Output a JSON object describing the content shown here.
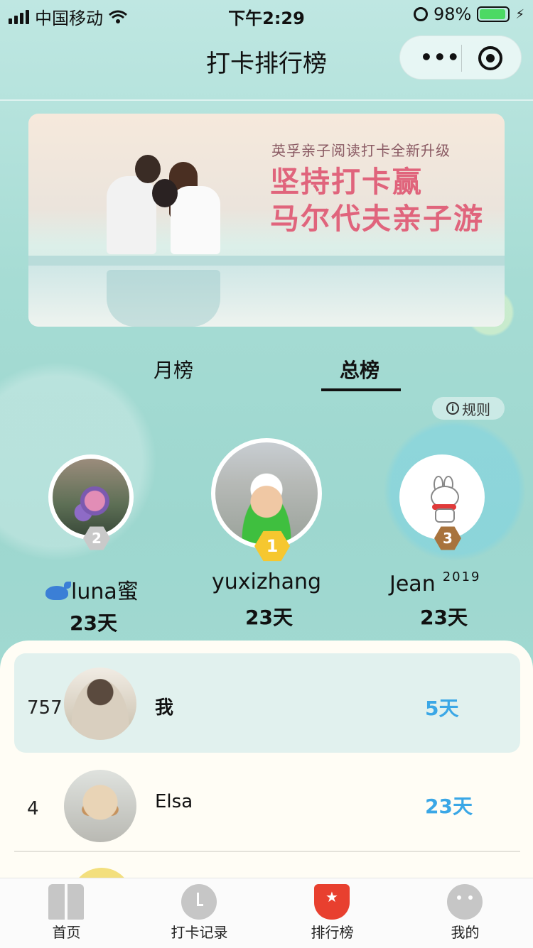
{
  "status_bar": {
    "carrier": "中国移动",
    "time": "下午2:29",
    "battery": "98%"
  },
  "nav": {
    "title": "打卡排行榜"
  },
  "banner": {
    "subtitle": "英孚亲子阅读打卡全新升级",
    "headline_1": "坚持打卡赢",
    "headline_2": "马尔代夫亲子游"
  },
  "tabs": [
    {
      "label": "月榜",
      "active": false
    },
    {
      "label": "总榜",
      "active": true
    }
  ],
  "rules_label": "规则",
  "podium": [
    {
      "rank": "2",
      "name": "luna蜜",
      "days": "23天"
    },
    {
      "rank": "1",
      "name": "yuxizhang",
      "days": "23天"
    },
    {
      "rank": "3",
      "name": "Jean",
      "name_suffix": "2019",
      "days": "23天"
    }
  ],
  "list": [
    {
      "rank": "757",
      "name": "我",
      "days": "5天",
      "highlighted": true
    },
    {
      "rank": "4",
      "name": "Elsa",
      "days": "23天",
      "highlighted": false
    }
  ],
  "tabbar": [
    {
      "label": "首页",
      "icon": "book-icon",
      "active": false
    },
    {
      "label": "打卡记录",
      "icon": "clock-icon",
      "active": false
    },
    {
      "label": "排行榜",
      "icon": "trophy-icon",
      "active": true
    },
    {
      "label": "我的",
      "icon": "face-icon",
      "active": false
    }
  ],
  "colors": {
    "accent_days": "#3aa7e6",
    "gold": "#f6c72f",
    "silver": "#c9c9c9",
    "bronze": "#a8733d",
    "tab_active": "#e8402f"
  }
}
